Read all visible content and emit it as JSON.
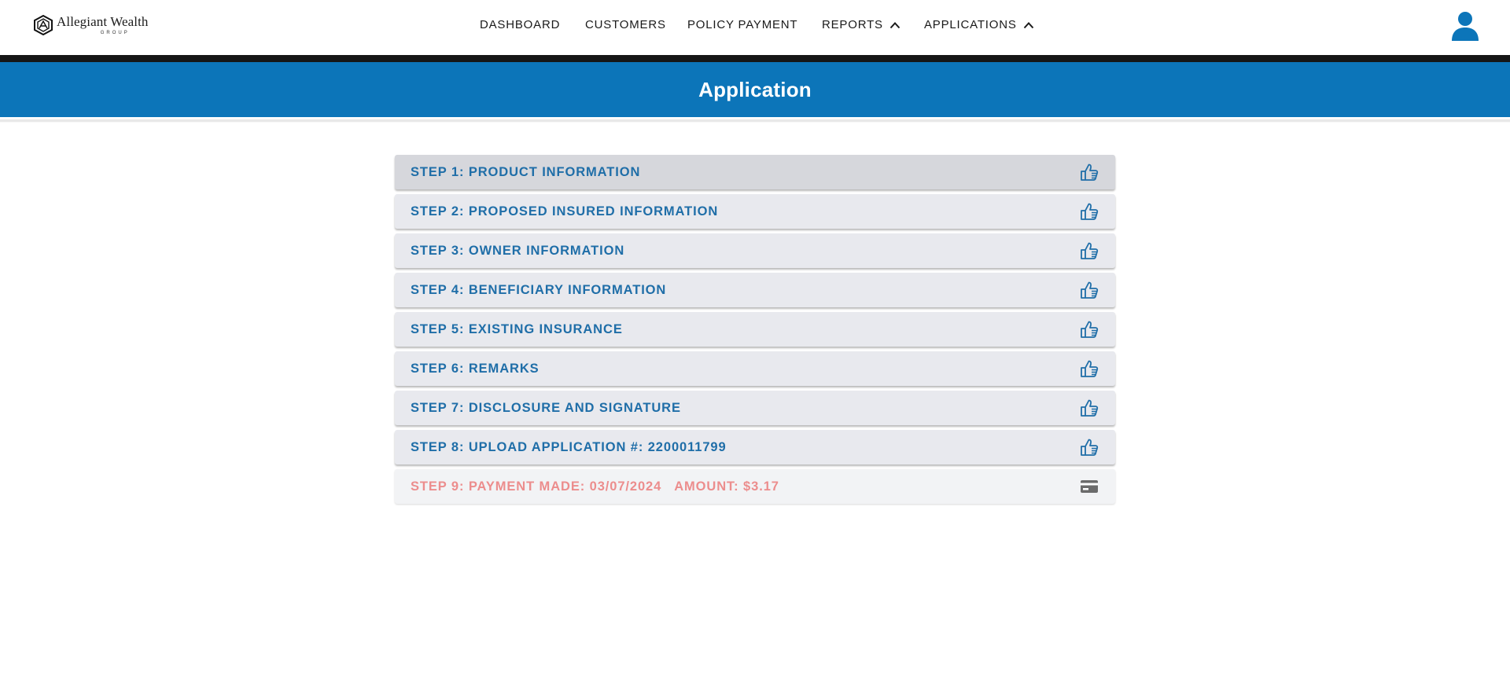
{
  "brand": {
    "name": "Allegiant Wealth",
    "sub": "GROUP"
  },
  "nav": {
    "items": [
      {
        "label": "DASHBOARD"
      },
      {
        "label": "CUSTOMERS"
      },
      {
        "label": "POLICY PAYMENT"
      },
      {
        "label": "REPORTS",
        "icon": "chevron-up-icon"
      },
      {
        "label": "APPLICATIONS",
        "icon": "chevron-up-icon"
      }
    ],
    "user_icon": "user-icon"
  },
  "page": {
    "title": "Application"
  },
  "steps": [
    {
      "label": "STEP 1: PRODUCT INFORMATION",
      "icon": "thumbs-up-icon",
      "state": "active"
    },
    {
      "label": "STEP 2: PROPOSED INSURED INFORMATION",
      "icon": "thumbs-up-icon"
    },
    {
      "label": "STEP 3: OWNER INFORMATION",
      "icon": "thumbs-up-icon"
    },
    {
      "label": "STEP 4: BENEFICIARY INFORMATION",
      "icon": "thumbs-up-icon"
    },
    {
      "label": "STEP 5: EXISTING INSURANCE",
      "icon": "thumbs-up-icon"
    },
    {
      "label": "STEP 6: REMARKS",
      "icon": "thumbs-up-icon"
    },
    {
      "label": "STEP 7: DISCLOSURE AND SIGNATURE",
      "icon": "thumbs-up-icon"
    },
    {
      "label": "STEP 8: UPLOAD APPLICATION #: 2200011799",
      "icon": "thumbs-up-icon"
    }
  ],
  "payment_step": {
    "label": "STEP 9: PAYMENT MADE: 03/07/2024",
    "amount": "AMOUNT: $3.17",
    "icon": "credit-card-icon"
  },
  "colors": {
    "primary": "#0c75b9",
    "step_text": "#1f6ea8",
    "payment_text": "#ec8d8d",
    "step_bg": "#e8e9ee",
    "step_active_bg": "#d6d7dc",
    "dark_strip": "#161616"
  }
}
